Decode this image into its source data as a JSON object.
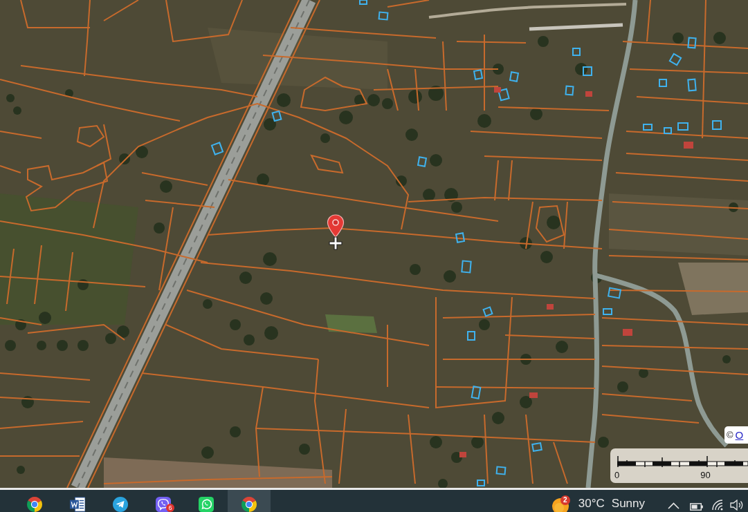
{
  "map": {
    "attribution": {
      "prefix": "©",
      "link": "O"
    },
    "scale": {
      "labels": [
        "0",
        "90"
      ]
    }
  },
  "taskbar": {
    "apps": [
      {
        "kind": "browser",
        "selected": false
      },
      {
        "kind": "document",
        "selected": false
      },
      {
        "kind": "plane",
        "selected": false
      },
      {
        "kind": "phone-bubble",
        "selected": false,
        "badge": "6"
      },
      {
        "kind": "chat",
        "selected": false
      },
      {
        "kind": "browser",
        "selected": true
      }
    ],
    "weather": {
      "badge": "2",
      "temperature": "30°C",
      "condition": "Sunny"
    },
    "tray": [
      {
        "kind": "chevron"
      },
      {
        "kind": "battery"
      },
      {
        "kind": "wifi"
      },
      {
        "kind": "speaker"
      }
    ]
  }
}
